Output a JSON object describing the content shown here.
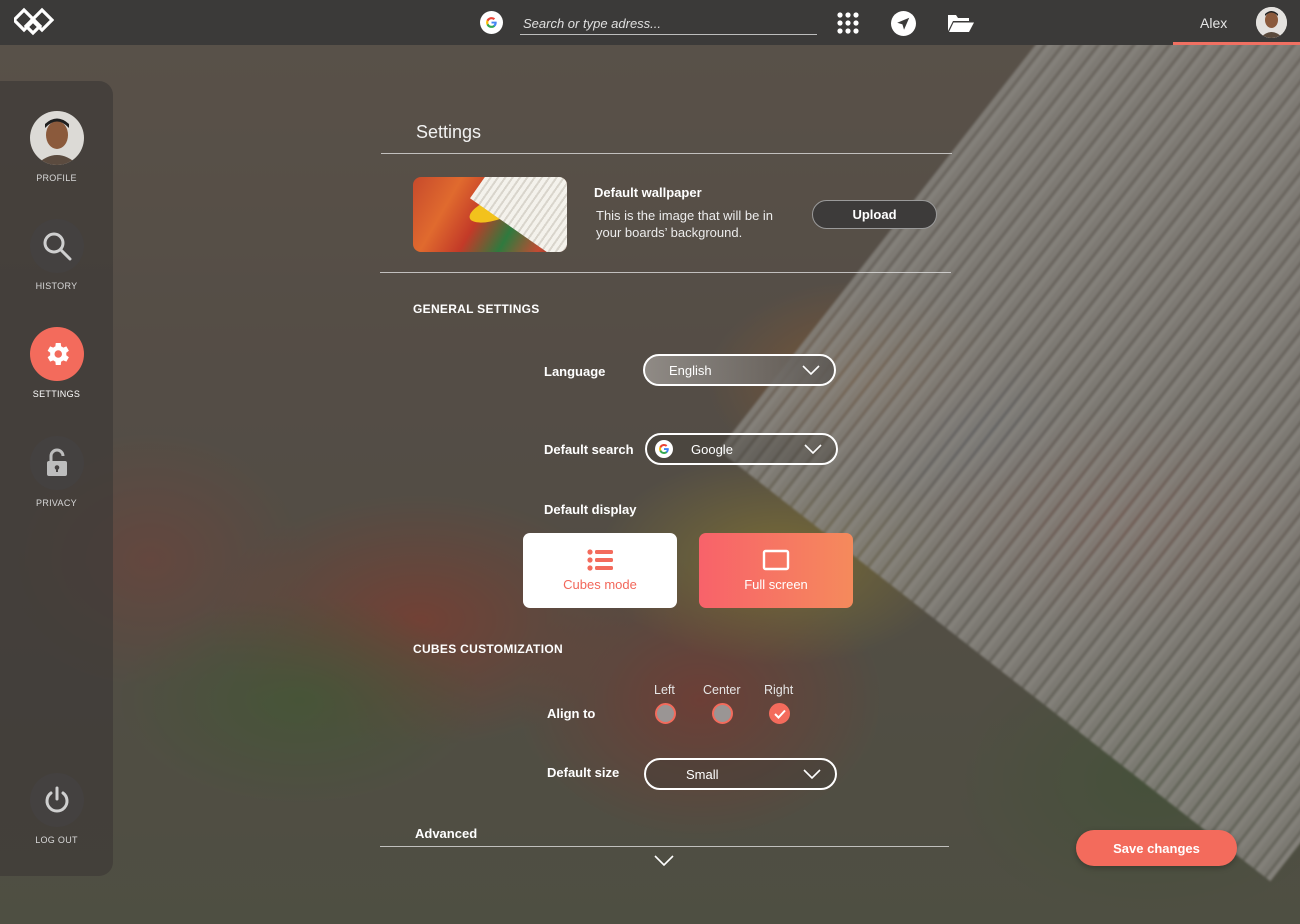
{
  "topbar": {
    "search_placeholder": "Search or type adress...",
    "username": "Alex",
    "icons": [
      "logo-icon",
      "google-icon",
      "apps-grid-icon",
      "navigation-arrow-icon",
      "folder-open-icon"
    ]
  },
  "sidebar": {
    "items": [
      {
        "label": "PROFILE",
        "icon": "avatar"
      },
      {
        "label": "HISTORY",
        "icon": "search-icon"
      },
      {
        "label": "SETTINGS",
        "icon": "gear-icon",
        "active": true
      },
      {
        "label": "PRIVACY",
        "icon": "lock-icon"
      }
    ],
    "logout_label": "LOG OUT"
  },
  "settings": {
    "title": "Settings",
    "wallpaper": {
      "title": "Default wallpaper",
      "description": "This is the image that  will be in your boards’ background.",
      "upload_label": "Upload"
    },
    "general": {
      "heading": "GENERAL SETTINGS",
      "language_label": "Language",
      "language_value": "English",
      "search_label": "Default search",
      "search_value": "Google",
      "display_label": "Default display",
      "display_modes": [
        {
          "label": "Cubes mode",
          "selected": false
        },
        {
          "label": "Full screen",
          "selected": true
        }
      ]
    },
    "cubes": {
      "heading": "CUBES CUSTOMIZATION",
      "align_label": "Align to",
      "align_options": [
        {
          "label": "Left",
          "checked": false
        },
        {
          "label": "Center",
          "checked": false
        },
        {
          "label": "Right",
          "checked": true
        }
      ],
      "size_label": "Default size",
      "size_value": "Small"
    },
    "advanced_label": "Advanced",
    "save_label": "Save changes"
  },
  "colors": {
    "accent": "#f36b5c",
    "topbar": "#3b3a39"
  }
}
